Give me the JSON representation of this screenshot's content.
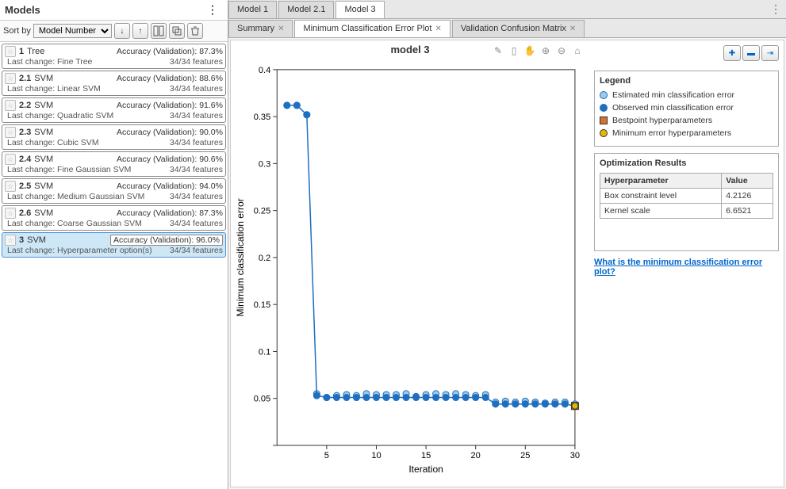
{
  "left": {
    "title": "Models",
    "sort_label": "Sort by",
    "sort_options": [
      "Model Number"
    ],
    "models": [
      {
        "num": "1",
        "type": "Tree",
        "acc": "Accuracy (Validation): 87.3%",
        "change": "Last change: Fine Tree",
        "feat": "34/34 features",
        "sel": false
      },
      {
        "num": "2.1",
        "type": "SVM",
        "acc": "Accuracy (Validation): 88.6%",
        "change": "Last change: Linear SVM",
        "feat": "34/34 features",
        "sel": false
      },
      {
        "num": "2.2",
        "type": "SVM",
        "acc": "Accuracy (Validation): 91.6%",
        "change": "Last change: Quadratic SVM",
        "feat": "34/34 features",
        "sel": false
      },
      {
        "num": "2.3",
        "type": "SVM",
        "acc": "Accuracy (Validation): 90.0%",
        "change": "Last change: Cubic SVM",
        "feat": "34/34 features",
        "sel": false
      },
      {
        "num": "2.4",
        "type": "SVM",
        "acc": "Accuracy (Validation): 90.6%",
        "change": "Last change: Fine Gaussian SVM",
        "feat": "34/34 features",
        "sel": false
      },
      {
        "num": "2.5",
        "type": "SVM",
        "acc": "Accuracy (Validation): 94.0%",
        "change": "Last change: Medium Gaussian SVM",
        "feat": "34/34 features",
        "sel": false
      },
      {
        "num": "2.6",
        "type": "SVM",
        "acc": "Accuracy (Validation): 87.3%",
        "change": "Last change: Coarse Gaussian SVM",
        "feat": "34/34 features",
        "sel": false
      },
      {
        "num": "3",
        "type": "SVM",
        "acc": "Accuracy (Validation): 96.0%",
        "change": "Last change: Hyperparameter option(s)",
        "feat": "34/34 features",
        "sel": true
      }
    ]
  },
  "main_tabs": [
    {
      "label": "Model 1",
      "act": false
    },
    {
      "label": "Model 2.1",
      "act": false
    },
    {
      "label": "Model 3",
      "act": true
    }
  ],
  "sub_tabs": [
    {
      "label": "Summary",
      "act": false,
      "close": true
    },
    {
      "label": "Minimum Classification Error Plot",
      "act": true,
      "close": true
    },
    {
      "label": "Validation Confusion Matrix",
      "act": false,
      "close": true
    }
  ],
  "chart_data": {
    "type": "line",
    "title": "model 3",
    "xlabel": "Iteration",
    "ylabel": "Minimum classification error",
    "xlim": [
      0,
      30
    ],
    "ylim": [
      0,
      0.4
    ],
    "xticks": [
      5,
      10,
      15,
      20,
      25,
      30
    ],
    "yticks": [
      0,
      0.05,
      0.1,
      0.15,
      0.2,
      0.25,
      0.3,
      0.35,
      0.4
    ],
    "series": [
      {
        "name": "Estimated min classification error",
        "color": "#9ec9e8",
        "marker": "circle",
        "x": [
          1,
          2,
          3,
          4,
          5,
          6,
          7,
          8,
          9,
          10,
          11,
          12,
          13,
          14,
          15,
          16,
          17,
          18,
          19,
          20,
          21,
          22,
          23,
          24,
          25,
          26,
          27,
          28,
          29,
          30
        ],
        "y": [
          0.362,
          0.362,
          0.352,
          0.055,
          0.051,
          0.053,
          0.054,
          0.053,
          0.055,
          0.054,
          0.054,
          0.054,
          0.055,
          0.052,
          0.054,
          0.055,
          0.054,
          0.055,
          0.054,
          0.053,
          0.054,
          0.046,
          0.047,
          0.046,
          0.047,
          0.046,
          0.045,
          0.046,
          0.046,
          0.044
        ]
      },
      {
        "name": "Observed min classification error",
        "color": "#1f6fc0",
        "marker": "circle",
        "line": true,
        "x": [
          1,
          2,
          3,
          4,
          5,
          6,
          7,
          8,
          9,
          10,
          11,
          12,
          13,
          14,
          15,
          16,
          17,
          18,
          19,
          20,
          21,
          22,
          23,
          24,
          25,
          26,
          27,
          28,
          29,
          30
        ],
        "y": [
          0.362,
          0.362,
          0.352,
          0.053,
          0.051,
          0.051,
          0.051,
          0.051,
          0.051,
          0.051,
          0.051,
          0.051,
          0.051,
          0.051,
          0.051,
          0.051,
          0.051,
          0.051,
          0.051,
          0.051,
          0.051,
          0.044,
          0.044,
          0.044,
          0.044,
          0.044,
          0.044,
          0.044,
          0.044,
          0.042
        ]
      },
      {
        "name": "Bestpoint hyperparameters",
        "color": "#d96f2e",
        "marker": "square",
        "x": [
          30
        ],
        "y": [
          0.042
        ]
      },
      {
        "name": "Minimum error hyperparameters",
        "color": "#e5b800",
        "marker": "circle",
        "x": [
          30
        ],
        "y": [
          0.042
        ]
      }
    ]
  },
  "legend": {
    "title": "Legend",
    "items": [
      {
        "label": "Estimated min classification error",
        "fill": "#9ec9e8",
        "stroke": "#1f6fc0",
        "shape": "circle"
      },
      {
        "label": "Observed min classification error",
        "fill": "#1f6fc0",
        "stroke": "#1f6fc0",
        "shape": "circle"
      },
      {
        "label": "Bestpoint hyperparameters",
        "fill": "#d96f2e",
        "stroke": "#333",
        "shape": "square"
      },
      {
        "label": "Minimum error hyperparameters",
        "fill": "#e5b800",
        "stroke": "#333",
        "shape": "circle"
      }
    ]
  },
  "results": {
    "title": "Optimization Results",
    "header1": "Hyperparameter",
    "header2": "Value",
    "rows": [
      {
        "k": "Box constraint level",
        "v": "4.2126"
      },
      {
        "k": "Kernel scale",
        "v": "6.6521"
      }
    ]
  },
  "help_link": "What is the minimum classification error plot?"
}
